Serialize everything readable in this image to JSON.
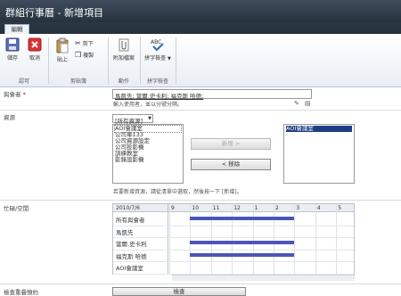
{
  "window": {
    "title": "群組行事曆 - 新增項目"
  },
  "tabs": [
    {
      "label": "編輯"
    }
  ],
  "ribbon": {
    "commit": {
      "save": "儲存",
      "cancel": "取消",
      "group": "認可"
    },
    "clipboard": {
      "paste": "貼上",
      "cut": "剪下",
      "copy": "複製",
      "group": "剪貼簿"
    },
    "actions": {
      "attach": "附加檔案",
      "group": "動作"
    },
    "spelling": {
      "spell_check": "拼字檢查",
      "group": "拼字檢查"
    }
  },
  "form": {
    "attendees": {
      "label": "與會者",
      "required_mark": "*",
      "value": "馬凱先; 當爾.史卡利; 福克斯 哈德;",
      "hint": "輸入使用者，並以分號分隔。"
    },
    "resources": {
      "label": "資源",
      "filter_value": "[所有資源]",
      "available": [
        "AOI會議室",
        "公司車133",
        "公司資源設定",
        "公司投影機",
        "訓練教室",
        "影錄設影機"
      ],
      "selected": [
        "AOI會議室"
      ],
      "add_button": "新增 >",
      "remove_button": "< 移除",
      "hint": "若要新增資源，請從清單中選取，然後按一下 [新增]。"
    },
    "availability": {
      "label": "忙碌/空閒",
      "date": "2010/7/6",
      "hours": [
        "9",
        "10",
        "11",
        "12",
        "1",
        "2",
        "3",
        "4",
        "5"
      ],
      "rows": [
        {
          "name": "所有與會者",
          "busy": [
            {
              "start": 10.0,
              "end": 15.0
            }
          ]
        },
        {
          "name": "馬凱先",
          "busy": []
        },
        {
          "name": "當爾.史卡利",
          "busy": [
            {
              "start": 10.0,
              "end": 15.0
            }
          ]
        },
        {
          "name": "福克斯 哈德",
          "busy": [
            {
              "start": 10.0,
              "end": 15.0
            }
          ]
        },
        {
          "name": "AOI會議室",
          "busy": []
        }
      ]
    },
    "recurrence": {
      "label": "檢查重疊預約",
      "button": "檢查"
    }
  }
}
